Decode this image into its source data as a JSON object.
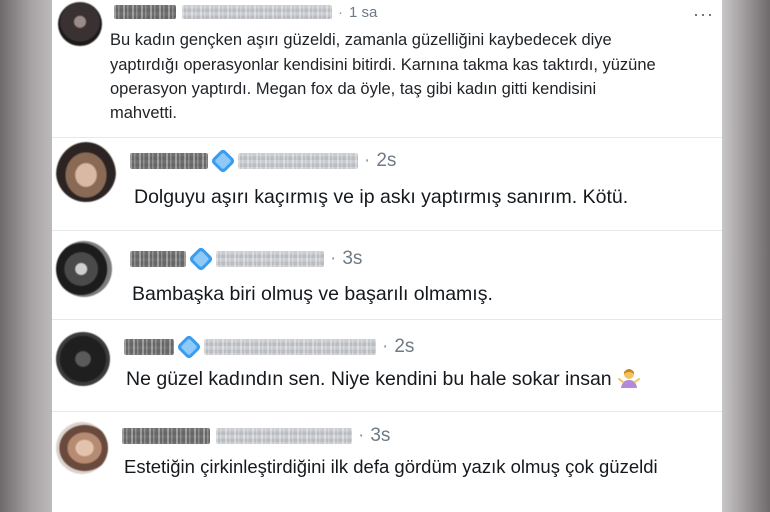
{
  "replies": [
    {
      "time": "1 sa",
      "dot": "·",
      "text_lines": [
        "Bu kadın gençken aşırı güzeldi, zamanla güzelliğini kaybedecek diye",
        "yaptırdığı operasyonlar kendisini bitirdi. Karnına takma kas taktırdı, yüzüne",
        "operasyon yaptırdı. Megan fox da öyle, taş gibi kadın gitti kendisini",
        "mahvetti."
      ],
      "more_icon": "more-horizontal-icon",
      "more_label": "···"
    },
    {
      "time": "2s",
      "dot": "·",
      "verified": true,
      "text": "Dolguyu aşırı kaçırmış ve ip askı yaptırmış sanırım. Kötü."
    },
    {
      "time": "3s",
      "dot": "·",
      "verified": true,
      "text": "Bambaşka biri olmuş ve başarılı olmamış."
    },
    {
      "time": "2s",
      "dot": "·",
      "verified": true,
      "text": "Ne güzel kadındın sen. Niye kendini bu hale sokar insan",
      "emoji": "person-shrugging-emoji"
    },
    {
      "time": "3s",
      "dot": "·",
      "verified": false,
      "text": "Estetiğin çirkinleştirdiğini ilk defa gördüm yazık olmuş çok güzeldi"
    }
  ],
  "colors": {
    "verified": "#3b9df0",
    "text": "#0f1419",
    "muted": "#6f7a84",
    "divider": "#e6e9eb"
  }
}
